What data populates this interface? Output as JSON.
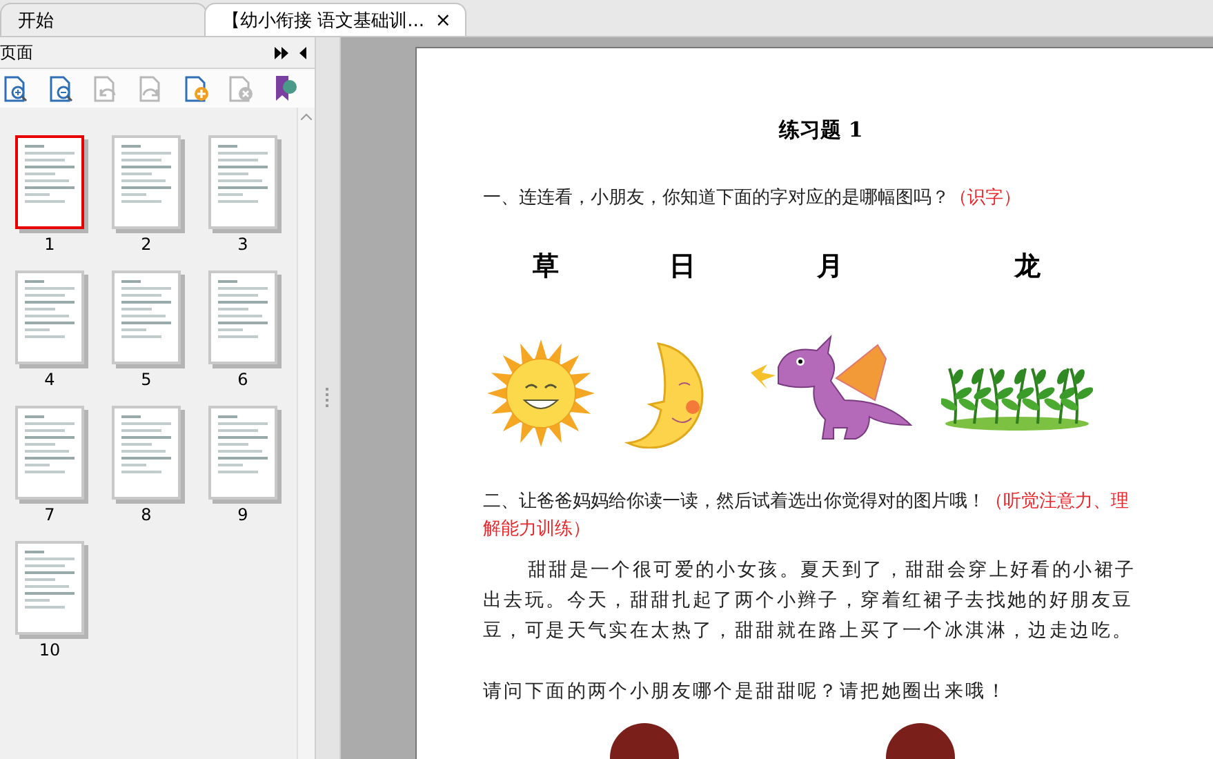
{
  "tabs": [
    {
      "label": "开始",
      "selected": false
    },
    {
      "label": "【幼小衔接 语文基础训...",
      "selected": true,
      "close": "×"
    }
  ],
  "side_panel": {
    "title": "页面",
    "toolbar": [
      {
        "kind": "zoom-in",
        "disabled": false
      },
      {
        "kind": "zoom-out",
        "disabled": false
      },
      {
        "kind": "rotate-left",
        "disabled": true
      },
      {
        "kind": "rotate-right",
        "disabled": true
      },
      {
        "kind": "insert",
        "disabled": false
      },
      {
        "kind": "delete",
        "disabled": true
      },
      {
        "kind": "bookmark",
        "disabled": false
      }
    ],
    "thumbnails": [
      {
        "label": "1",
        "selected": true
      },
      {
        "label": "2",
        "selected": false
      },
      {
        "label": "3",
        "selected": false
      },
      {
        "label": "4",
        "selected": false
      },
      {
        "label": "5",
        "selected": false
      },
      {
        "label": "6",
        "selected": false
      },
      {
        "label": "7",
        "selected": false
      },
      {
        "label": "8",
        "selected": false
      },
      {
        "label": "9",
        "selected": false
      },
      {
        "label": "10",
        "selected": false
      }
    ]
  },
  "document": {
    "title": "练习题 1",
    "question_1": {
      "text": "一、连连看，小朋友，你知道下面的字对应的是哪幅图吗？",
      "tag": "（识字）"
    },
    "characters": [
      "草",
      "日",
      "月",
      "龙"
    ],
    "pictures": [
      {
        "kind": "sun"
      },
      {
        "kind": "moon"
      },
      {
        "kind": "dragon"
      },
      {
        "kind": "grass"
      }
    ],
    "question_2": {
      "text": "二、让爸爸妈妈给你读一读，然后试着选出你觉得对的图片哦！",
      "tag": "（听觉注意力、理解能力训练）"
    },
    "story": "甜甜是一个很可爱的小女孩。夏天到了，甜甜会穿上好看的小裙子出去玩。今天，甜甜扎起了两个小辫子，穿着红裙子去找她的好朋友豆豆，可是天气实在太热了，甜甜就在路上买了一个冰淇淋，边走边吃。",
    "prompt": "请问下面的两个小朋友哪个是甜甜呢？请把她圈出来哦！"
  }
}
